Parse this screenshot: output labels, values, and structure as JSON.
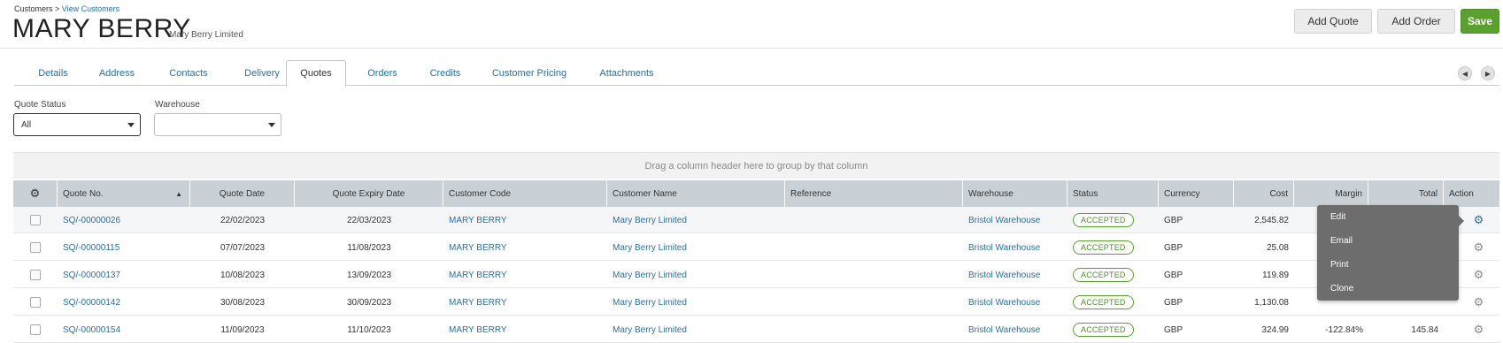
{
  "breadcrumb": {
    "root": "Customers",
    "sep": " > ",
    "current": "View Customers"
  },
  "header": {
    "title": "MARY BERRY",
    "subtitle": "Mary Berry Limited"
  },
  "buttons": {
    "add_quote": "Add Quote",
    "add_order": "Add Order",
    "save": "Save"
  },
  "tabs": [
    "Details",
    "Address",
    "Contacts",
    "Delivery",
    "Quotes",
    "Orders",
    "Credits",
    "Customer Pricing",
    "Attachments"
  ],
  "active_tab": "Quotes",
  "filters": {
    "quote_status_label": "Quote Status",
    "quote_status_value": "All",
    "warehouse_label": "Warehouse",
    "warehouse_value": ""
  },
  "group_hint": "Drag a column header here to group by that column",
  "columns": [
    "Quote No.",
    "Quote Date",
    "Quote Expiry Date",
    "Customer Code",
    "Customer Name",
    "Reference",
    "Warehouse",
    "Status",
    "Currency",
    "Cost",
    "Margin",
    "Total",
    "Action"
  ],
  "rows": [
    {
      "quote_no": "SQ/-00000026",
      "quote_date": "22/02/2023",
      "expiry": "22/03/2023",
      "code": "MARY BERRY",
      "name": "Mary Berry Limited",
      "reference": "",
      "warehouse": "Bristol Warehouse",
      "status": "ACCEPTED",
      "currency": "GBP",
      "cost": "2,545.82",
      "margin": "",
      "total": ""
    },
    {
      "quote_no": "SQ/-00000115",
      "quote_date": "07/07/2023",
      "expiry": "11/08/2023",
      "code": "MARY BERRY",
      "name": "Mary Berry Limited",
      "reference": "",
      "warehouse": "Bristol Warehouse",
      "status": "ACCEPTED",
      "currency": "GBP",
      "cost": "25.08",
      "margin": "",
      "total": ""
    },
    {
      "quote_no": "SQ/-00000137",
      "quote_date": "10/08/2023",
      "expiry": "13/09/2023",
      "code": "MARY BERRY",
      "name": "Mary Berry Limited",
      "reference": "",
      "warehouse": "Bristol Warehouse",
      "status": "ACCEPTED",
      "currency": "GBP",
      "cost": "119.89",
      "margin": "",
      "total": ""
    },
    {
      "quote_no": "SQ/-00000142",
      "quote_date": "30/08/2023",
      "expiry": "30/09/2023",
      "code": "MARY BERRY",
      "name": "Mary Berry Limited",
      "reference": "",
      "warehouse": "Bristol Warehouse",
      "status": "ACCEPTED",
      "currency": "GBP",
      "cost": "1,130.08",
      "margin": "",
      "total": ""
    },
    {
      "quote_no": "SQ/-00000154",
      "quote_date": "11/09/2023",
      "expiry": "11/10/2023",
      "code": "MARY BERRY",
      "name": "Mary Berry Limited",
      "reference": "",
      "warehouse": "Bristol Warehouse",
      "status": "ACCEPTED",
      "currency": "GBP",
      "cost": "324.99",
      "margin": "-122.84%",
      "total": "145.84"
    }
  ],
  "action_menu": [
    "Edit",
    "Email",
    "Print",
    "Clone"
  ],
  "icons": {
    "settings": "gear-icon",
    "sort": "sort-asc-icon",
    "prev": "chevron-left-icon",
    "next": "chevron-right-icon"
  },
  "colors": {
    "accent": "#2a6fa3",
    "save": "#5aa02c",
    "header_bg": "#c9d0d6",
    "menu_bg": "#6d6d6d"
  }
}
